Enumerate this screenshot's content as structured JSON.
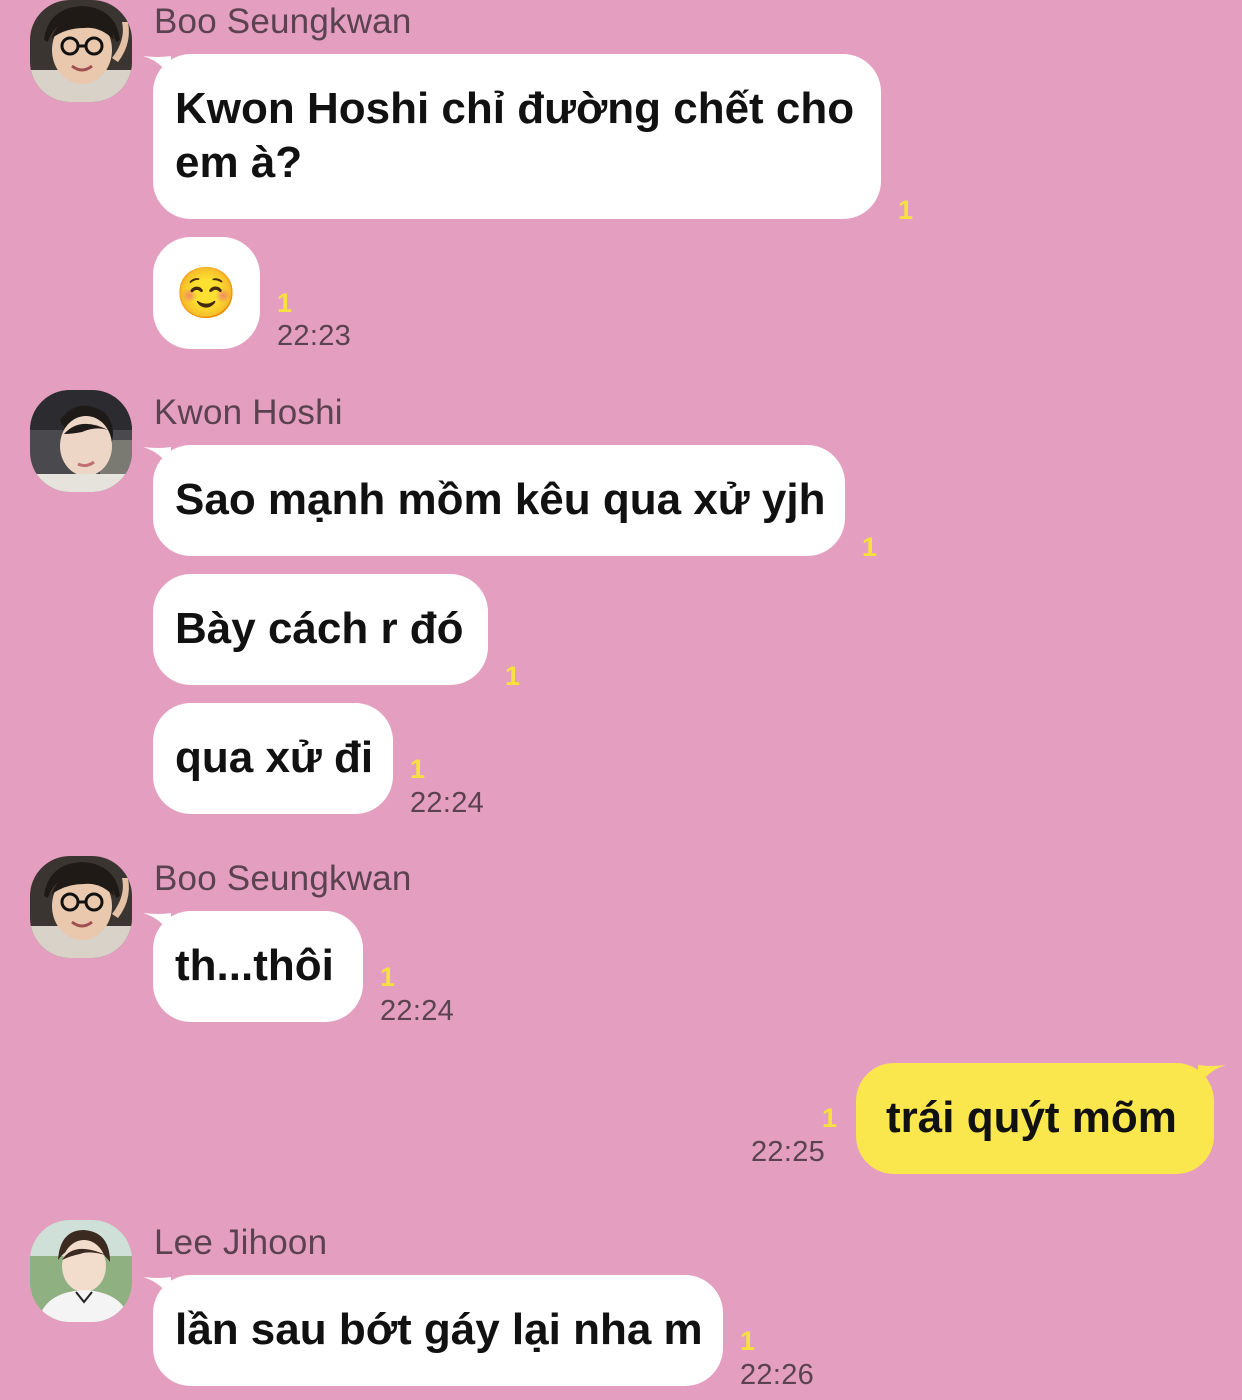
{
  "chat": {
    "groups": [
      {
        "sender": "Boo Seungkwan",
        "avatar": "avatar-boo-seungkwan",
        "messages": [
          {
            "text": "Kwon Hoshi chỉ đường chết cho em à?",
            "unread": "1"
          },
          {
            "text": "☺️",
            "unread": "1",
            "time": "22:23"
          }
        ]
      },
      {
        "sender": "Kwon Hoshi",
        "avatar": "avatar-kwon-hoshi",
        "messages": [
          {
            "text": "Sao mạnh mồm kêu qua xử yjh",
            "unread": "1"
          },
          {
            "text": "Bày cách r đó",
            "unread": "1"
          },
          {
            "text": "qua xử đi",
            "unread": "1",
            "time": "22:24"
          }
        ]
      },
      {
        "sender": "Boo Seungkwan",
        "avatar": "avatar-boo-seungkwan",
        "messages": [
          {
            "text": "th...thôi",
            "unread": "1",
            "time": "22:24"
          }
        ]
      },
      {
        "sender": "me",
        "messages": [
          {
            "text": "trái quýt mõm",
            "unread": "1",
            "time": "22:25"
          }
        ]
      },
      {
        "sender": "Lee Jihoon",
        "avatar": "avatar-lee-jihoon",
        "messages": [
          {
            "text": "lần sau bớt gáy lại nha m",
            "unread": "1",
            "time": "22:26"
          }
        ]
      }
    ]
  },
  "colors": {
    "background": "#e49fc0",
    "bubble_other": "#ffffff",
    "bubble_mine": "#fae64d",
    "unread_count": "#f7e13e",
    "meta_text": "#5a4250"
  }
}
